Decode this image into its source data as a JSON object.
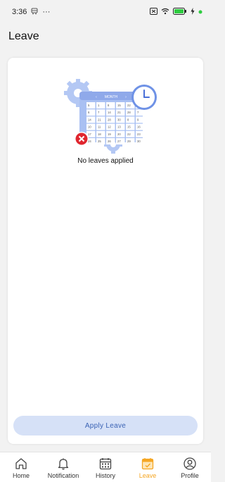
{
  "status_bar": {
    "time": "3:36",
    "more": "···"
  },
  "header": {
    "title": "Leave"
  },
  "main": {
    "empty_message": "No leaves applied",
    "apply_button_label": "Apply Leave",
    "calendar": {
      "title": "MONTH",
      "days": [
        "5",
        "1",
        "8",
        "15",
        "22",
        "29",
        "6",
        "7",
        "14",
        "21",
        "28",
        "7",
        "14",
        "21",
        "28",
        "30",
        "8",
        "9",
        "10",
        "11",
        "12",
        "13",
        "15",
        "16",
        "17",
        "18",
        "19",
        "20",
        "22",
        "23",
        "24",
        "25",
        "26",
        "27",
        "29",
        "30"
      ]
    }
  },
  "nav": {
    "items": [
      {
        "label": "Home",
        "icon": "home-icon"
      },
      {
        "label": "Notification",
        "icon": "bell-icon"
      },
      {
        "label": "History",
        "icon": "calendar-grid-icon"
      },
      {
        "label": "Leave",
        "icon": "calendar-check-icon"
      },
      {
        "label": "Profile",
        "icon": "user-icon"
      }
    ],
    "active_index": 3
  },
  "colors": {
    "accent": "#f5a623",
    "button_bg": "#d6e1f7",
    "button_text": "#3a62b4",
    "illustration_blue": "#a9c0f2"
  }
}
